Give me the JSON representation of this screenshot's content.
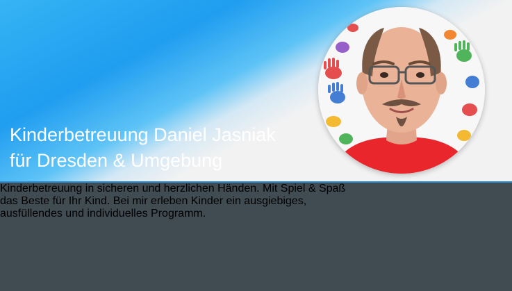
{
  "hero": {
    "title_line1": "Kinderbetreuung Daniel Jasniak",
    "title_line2": "für Dresden & Umgebung",
    "portrait_icon": "person-photo",
    "gradient_colors": [
      "#1f9df0",
      "#5ec3f6",
      "#f2f2f2"
    ]
  },
  "intro": {
    "line1": "Kinderbetreuung in sicheren und herzlichen Händen. Mit Spiel & Spaß",
    "line2": "das Beste für Ihr Kind. Bei mir erleben Kinder ein ausgiebiges,",
    "line3": "ausfüllendes und individuelles Programm."
  },
  "colors": {
    "band_background": "#414b52",
    "accent_blue": "#1f9df0",
    "text": "#ffffff"
  }
}
